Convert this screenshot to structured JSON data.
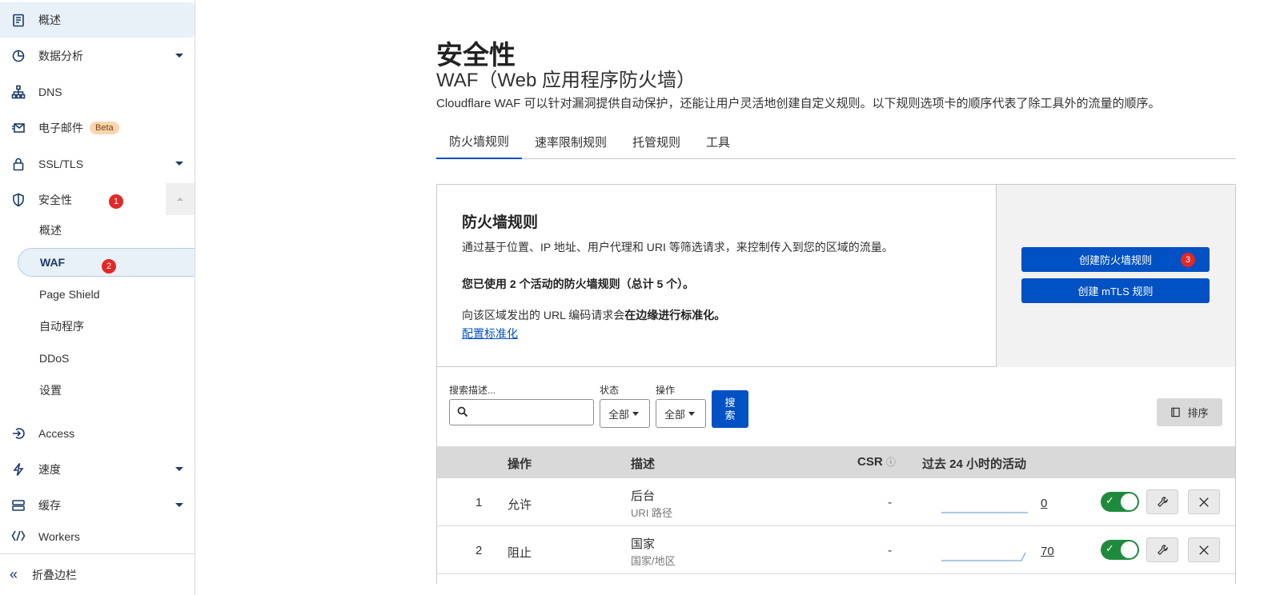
{
  "sidebar": {
    "items": [
      {
        "label": "概述",
        "icon": "clipboard-icon"
      },
      {
        "label": "数据分析",
        "icon": "pie-chart-icon"
      },
      {
        "label": "DNS",
        "icon": "network-icon"
      },
      {
        "label": "电子邮件",
        "icon": "email-icon",
        "badge": "Beta"
      },
      {
        "label": "SSL/TLS",
        "icon": "lock-icon"
      },
      {
        "label": "安全性",
        "icon": "shield-icon",
        "step": "1"
      },
      {
        "label": "Access",
        "icon": "access-icon"
      },
      {
        "label": "速度",
        "icon": "lightning-icon"
      },
      {
        "label": "缓存",
        "icon": "cache-icon"
      },
      {
        "label": "Workers",
        "icon": "workers-icon"
      }
    ],
    "security_sub": [
      {
        "label": "概述"
      },
      {
        "label": "WAF",
        "step": "2"
      },
      {
        "label": "Page Shield"
      },
      {
        "label": "自动程序"
      },
      {
        "label": "DDoS"
      },
      {
        "label": "设置"
      }
    ],
    "collapse_label": "折叠边栏"
  },
  "page": {
    "title": "安全性",
    "subtitle": "WAF（Web 应用程序防火墙）",
    "description": "Cloudflare WAF 可以针对漏洞提供自动保护，还能让用户灵活地创建自定义规则。以下规则选项卡的顺序代表了除工具外的流量的顺序。"
  },
  "tabs": [
    "防火墙规则",
    "速率限制规则",
    "托管规则",
    "工具"
  ],
  "card": {
    "title": "防火墙规则",
    "description": "通过基于位置、IP 地址、用户代理和 URI 等筛选请求，来控制传入到您的区域的流量。",
    "usage": "您已使用 2 个活动的防火墙规则（总计 5 个）。",
    "url_prefix": "向该区域发出的 URL 编码请求会",
    "url_bold": "在边缘进行标准化。",
    "link": "配置标准化",
    "create_rule_button": "创建防火墙规则",
    "create_rule_step": "3",
    "create_mtls_button": "创建 mTLS 规则"
  },
  "filters": {
    "search_label": "搜索描述...",
    "search_value": "",
    "status_label": "状态",
    "status_value": "全部",
    "action_label": "操作",
    "action_value": "全部",
    "search_button": "搜索",
    "sort_button": "排序"
  },
  "table": {
    "headers": {
      "action": "操作",
      "description": "描述",
      "csr": "CSR",
      "activity": "过去 24 小时的活动"
    },
    "rows": [
      {
        "index": "1",
        "action": "允许",
        "description": "后台",
        "sub": "URI 路径",
        "csr": "-",
        "count": "0",
        "enabled": true
      },
      {
        "index": "2",
        "action": "阻止",
        "description": "国家",
        "sub": "国家/地区",
        "csr": "-",
        "count": "70",
        "enabled": true
      }
    ]
  },
  "colors": {
    "accent": "#0051c3",
    "toggle_on": "#1f8a3e",
    "badge_red": "#e52727",
    "beta_bg": "#f9d6b0"
  }
}
